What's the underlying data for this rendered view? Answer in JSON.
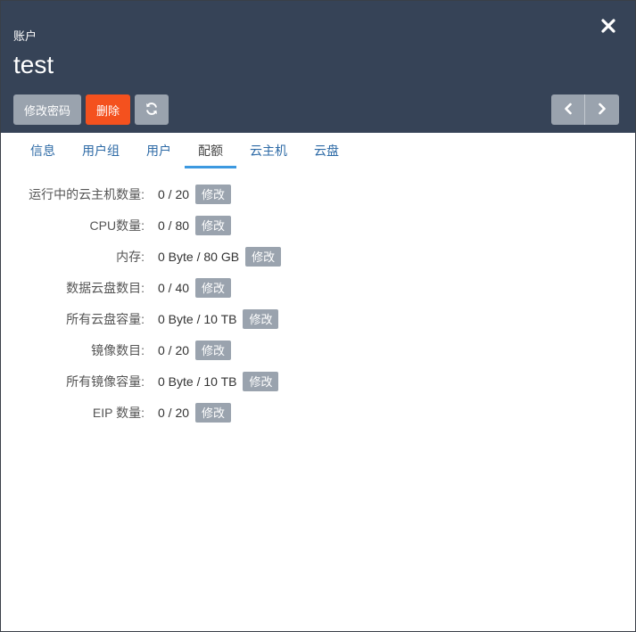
{
  "header": {
    "breadcrumb": "账户",
    "title": "test",
    "close_icon": "close-icon"
  },
  "toolbar": {
    "change_password_label": "修改密码",
    "delete_label": "删除",
    "refresh_icon": "refresh-icon"
  },
  "pager": {
    "prev_icon": "chevron-left-icon",
    "next_icon": "chevron-right-icon"
  },
  "tabs": [
    {
      "label": "信息",
      "active": false
    },
    {
      "label": "用户组",
      "active": false
    },
    {
      "label": "用户",
      "active": false
    },
    {
      "label": "配额",
      "active": true
    },
    {
      "label": "云主机",
      "active": false
    },
    {
      "label": "云盘",
      "active": false
    }
  ],
  "quota": {
    "edit_label": "修改",
    "rows": [
      {
        "label": "运行中的云主机数量:",
        "value": "0 / 20"
      },
      {
        "label": "CPU数量:",
        "value": "0 / 80"
      },
      {
        "label": "内存:",
        "value": "0 Byte / 80 GB"
      },
      {
        "label": "数据云盘数目:",
        "value": "0 / 40"
      },
      {
        "label": "所有云盘容量:",
        "value": "0 Byte / 10 TB"
      },
      {
        "label": "镜像数目:",
        "value": "0 / 20"
      },
      {
        "label": "所有镜像容量:",
        "value": "0 Byte / 10 TB"
      },
      {
        "label": "EIP 数量:",
        "value": "0 / 20"
      }
    ]
  },
  "colors": {
    "header_bg": "#364357",
    "delete": "#f4511e",
    "gray_button": "#9aa3ae",
    "tab_link": "#2d6aa6",
    "tab_underline": "#3c99e0"
  }
}
